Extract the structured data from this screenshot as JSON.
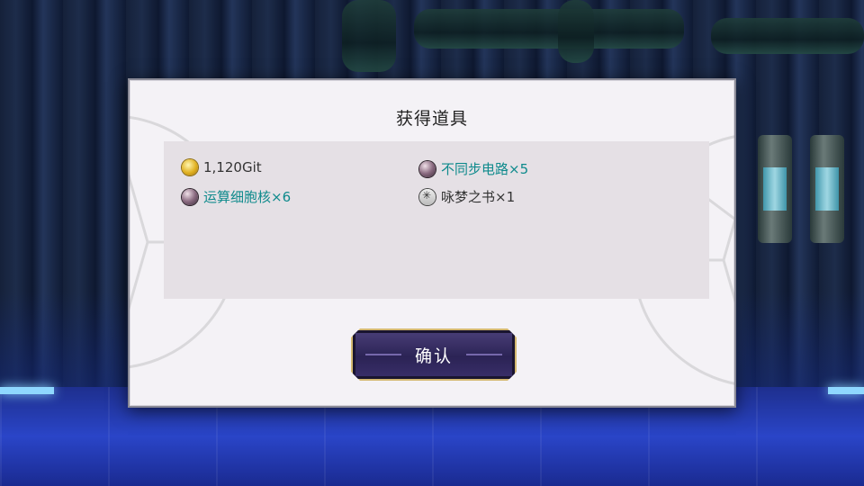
{
  "dialog": {
    "title": "获得道具",
    "items": [
      {
        "label": "1,120Git",
        "icon": "coin-icon"
      },
      {
        "label": "不同步电路×5",
        "icon": "purple-orb-icon",
        "color": "#0e8a8c"
      },
      {
        "label": "运算细胞核×6",
        "icon": "purple-orb-icon",
        "color": "#0e8a8c"
      },
      {
        "label": "咏梦之书×1",
        "icon": "book-icon"
      }
    ],
    "confirm_label": "确认"
  },
  "colors": {
    "accent_teal": "#0e8a8c",
    "button_border": "#d4b870",
    "button_fill": "#2b2355"
  }
}
